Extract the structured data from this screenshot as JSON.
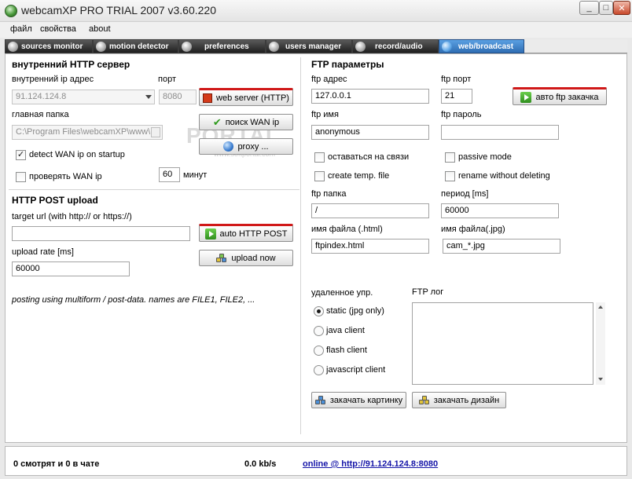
{
  "window": {
    "title": "webcamXP PRO TRIAL 2007 v3.60.220",
    "minimize_glyph": "_",
    "maximize_glyph": "□",
    "close_glyph": "✕"
  },
  "menu": [
    "файл",
    "свойства",
    "about"
  ],
  "tabs": [
    {
      "label": "sources monitor",
      "icon": "camera-icon"
    },
    {
      "label": "motion detector",
      "icon": "camera-icon"
    },
    {
      "label": "preferences",
      "icon": "gear-icon"
    },
    {
      "label": "users manager",
      "icon": "users-icon"
    },
    {
      "label": "record/audio",
      "icon": "microphone-icon"
    },
    {
      "label": "web/broadcast",
      "icon": "globe-icon",
      "active": true
    }
  ],
  "watermark": {
    "text": "PORTAL",
    "sub": "www.softportal.com"
  },
  "http_server": {
    "heading": "внутренний HTTP сервер",
    "ip_label": "внутренний ip адрес",
    "ip_value": "91.124.124.8",
    "port_label": "порт",
    "port_value": "8080",
    "web_server_button": "web server (HTTP)",
    "folder_label": "главная папка",
    "folder_value": "C:\\Program Files\\webcamXP\\www\\",
    "find_wan_button": "поиск WAN ip",
    "proxy_button": "proxy ...",
    "detect_wan_label": "detect WAN ip on startup",
    "detect_wan_checked": true,
    "check_wan_label": "проверять WAN ip",
    "check_wan_checked": false,
    "minutes_value": "60",
    "minutes_label": "минут"
  },
  "http_post": {
    "heading": "HTTP POST upload",
    "target_label": "target url (with http:// or https://)",
    "target_value": "",
    "auto_button": "auto HTTP POST",
    "rate_label": "upload rate [ms]",
    "rate_value": "60000",
    "upload_now_button": "upload now",
    "note": "posting using multiform / post-data. names are FILE1, FILE2, ..."
  },
  "ftp": {
    "heading": "FTP параметры",
    "address_label": "ftp адрес",
    "address_value": "127.0.0.1",
    "port_label": "ftp порт",
    "port_value": "21",
    "auto_button": "авто ftp закачка",
    "user_label": "ftp имя",
    "user_value": "anonymous",
    "password_label": "ftp пароль",
    "password_value": "",
    "stay_connected_label": "оставаться на связи",
    "passive_label": "passive mode",
    "temp_file_label": "create temp. file",
    "rename_label": "rename without deleting",
    "folder_label": "ftp папка",
    "folder_value": "/",
    "period_label": "период [ms]",
    "period_value": "60000",
    "html_name_label": "имя файла (.html)",
    "html_name_value": "ftpindex.html",
    "jpg_name_label": "имя файла(.jpg)",
    "jpg_name_value": "cam_*.jpg",
    "remote_label": "удаленное упр.",
    "remote_options": [
      "static (jpg only)",
      "java client",
      "flash client",
      "javascript client"
    ],
    "remote_selected": 0,
    "log_label": "FTP лог",
    "upload_image_button": "закачать картинку",
    "upload_design_button": "закачать дизайн"
  },
  "status": {
    "viewers": "0 смотрят и 0 в чате",
    "rate": "0.0 kb/s",
    "link": "online @ http://91.124.124.8:8080"
  }
}
